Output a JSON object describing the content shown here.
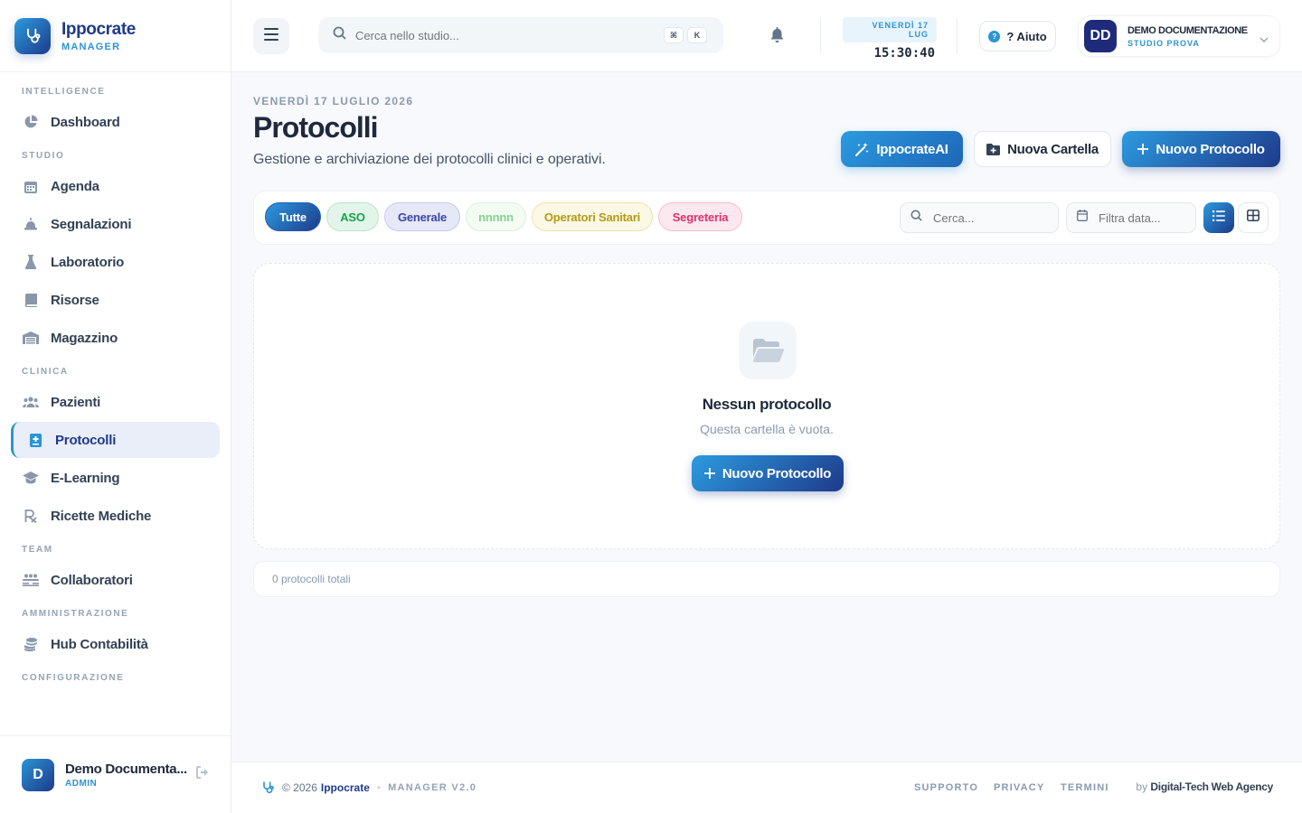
{
  "brand": {
    "name": "Ippocrate",
    "sub": "MANAGER"
  },
  "sidebar": {
    "sections": [
      {
        "title": "INTELLIGENCE",
        "items": [
          {
            "label": "Dashboard",
            "icon": "pie-chart-icon"
          }
        ]
      },
      {
        "title": "STUDIO",
        "items": [
          {
            "label": "Agenda",
            "icon": "calendar-icon"
          },
          {
            "label": "Segnalazioni",
            "icon": "alert-bell-icon"
          },
          {
            "label": "Laboratorio",
            "icon": "flask-icon"
          },
          {
            "label": "Risorse",
            "icon": "book-icon"
          },
          {
            "label": "Magazzino",
            "icon": "warehouse-icon"
          }
        ]
      },
      {
        "title": "CLINICA",
        "items": [
          {
            "label": "Pazienti",
            "icon": "users-icon"
          },
          {
            "label": "Protocolli",
            "icon": "medical-file-icon",
            "active": true
          },
          {
            "label": "E-Learning",
            "icon": "graduation-cap-icon"
          },
          {
            "label": "Ricette Mediche",
            "icon": "prescription-icon"
          }
        ]
      },
      {
        "title": "TEAM",
        "items": [
          {
            "label": "Collaboratori",
            "icon": "team-icon"
          }
        ]
      },
      {
        "title": "AMMINISTRAZIONE",
        "items": [
          {
            "label": "Hub Contabilità",
            "icon": "coins-icon"
          }
        ]
      },
      {
        "title": "CONFIGURAZIONE",
        "items": []
      }
    ],
    "user": {
      "initial": "D",
      "name": "Demo Documenta...",
      "role": "ADMIN"
    }
  },
  "topbar": {
    "search_placeholder": "Cerca nello studio...",
    "kbd1": "⌘",
    "kbd2": "K",
    "date": "VENERDÌ 17 LUG",
    "time": "15:30:40",
    "help": "? Aiuto",
    "profile": {
      "initials": "DD",
      "name": "DEMO DOCUMENTAZIONE",
      "sub": "STUDIO PROVA"
    }
  },
  "main": {
    "kicker": "VENERDÌ 17 LUGLIO 2026",
    "title": "Protocolli",
    "subtitle": "Gestione e archiviazione dei protocolli clinici e operativi.",
    "btn_ai": "IppocrateAI",
    "btn_folder": "Nuova Cartella",
    "btn_new": "Nuovo Protocollo",
    "filters": [
      {
        "label": "Tutte",
        "bg": "#1e5fb0",
        "color": "#ffffff",
        "border": "#1e5fb0"
      },
      {
        "label": "ASO",
        "bg": "#e3f5ea",
        "color": "#16a34a",
        "border": "#b7e4c7"
      },
      {
        "label": "Generale",
        "bg": "#e6e8f8",
        "color": "#3b45a8",
        "border": "#c4c9ee"
      },
      {
        "label": "nnnnn",
        "bg": "#f3fbf3",
        "color": "#86d38e",
        "border": "#d9f2dc"
      },
      {
        "label": "Operatori Sanitari",
        "bg": "#fbf8e6",
        "color": "#b59a12",
        "border": "#eee3a8"
      },
      {
        "label": "Segreteria",
        "bg": "#fde8ef",
        "color": "#e0316e",
        "border": "#f7bdd0"
      }
    ],
    "search_placeholder": "Cerca...",
    "date_placeholder": "Filtra data...",
    "empty_title": "Nessun protocollo",
    "empty_sub": "Questa cartella è vuota.",
    "empty_btn": "Nuovo Protocollo",
    "totals": "0 protocolli totali"
  },
  "footer": {
    "copyright": "© 2026",
    "brand": "Ippocrate",
    "version": "MANAGER V2.0",
    "links": [
      "SUPPORTO",
      "PRIVACY",
      "TERMINI"
    ],
    "by": "by",
    "agency": "Digital-Tech Web Agency"
  },
  "colors": {
    "accent": "#2a94d6",
    "brand_dark": "#1e3a8a"
  }
}
